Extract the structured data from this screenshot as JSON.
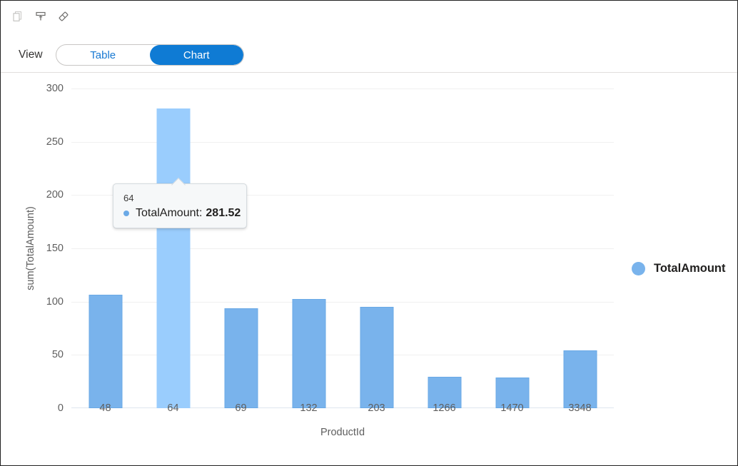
{
  "toolbar": {
    "buttons": [
      {
        "name": "copy-icon",
        "label": "Copy"
      },
      {
        "name": "pin-icon",
        "label": "Pin"
      },
      {
        "name": "eraser-icon",
        "label": "Clear"
      }
    ]
  },
  "view_switch": {
    "label": "View",
    "options": [
      {
        "label": "Table",
        "selected": false
      },
      {
        "label": "Chart",
        "selected": true
      }
    ],
    "selected": "Chart",
    "accent_color": "#0f7bd4"
  },
  "legend": {
    "items": [
      {
        "label": "TotalAmount",
        "color": "#79b3ec"
      }
    ]
  },
  "tooltip": {
    "header": "64",
    "series": "TotalAmount",
    "separator": ":",
    "value": "281.52",
    "marker_color": "#6aa9e6"
  },
  "chart_data": {
    "type": "bar",
    "title": "",
    "xlabel": "ProductId",
    "ylabel": "sum(TotalAmount)",
    "categories": [
      "48",
      "64",
      "69",
      "132",
      "203",
      "1266",
      "1470",
      "3348"
    ],
    "values": [
      106.5,
      281.52,
      93.5,
      102.5,
      95,
      29.5,
      28.5,
      54.5
    ],
    "series": [
      {
        "name": "TotalAmount",
        "values": [
          106.5,
          281.52,
          93.5,
          102.5,
          95,
          29.5,
          28.5,
          54.5
        ]
      }
    ],
    "highlighted_category": "64",
    "ylim": [
      0,
      300
    ],
    "yticks": [
      300,
      250,
      200,
      150,
      100,
      50,
      0
    ],
    "grid": true,
    "legend_position": "right",
    "bar_color": "#79b3ec",
    "highlight_color": "#9acdfd"
  }
}
